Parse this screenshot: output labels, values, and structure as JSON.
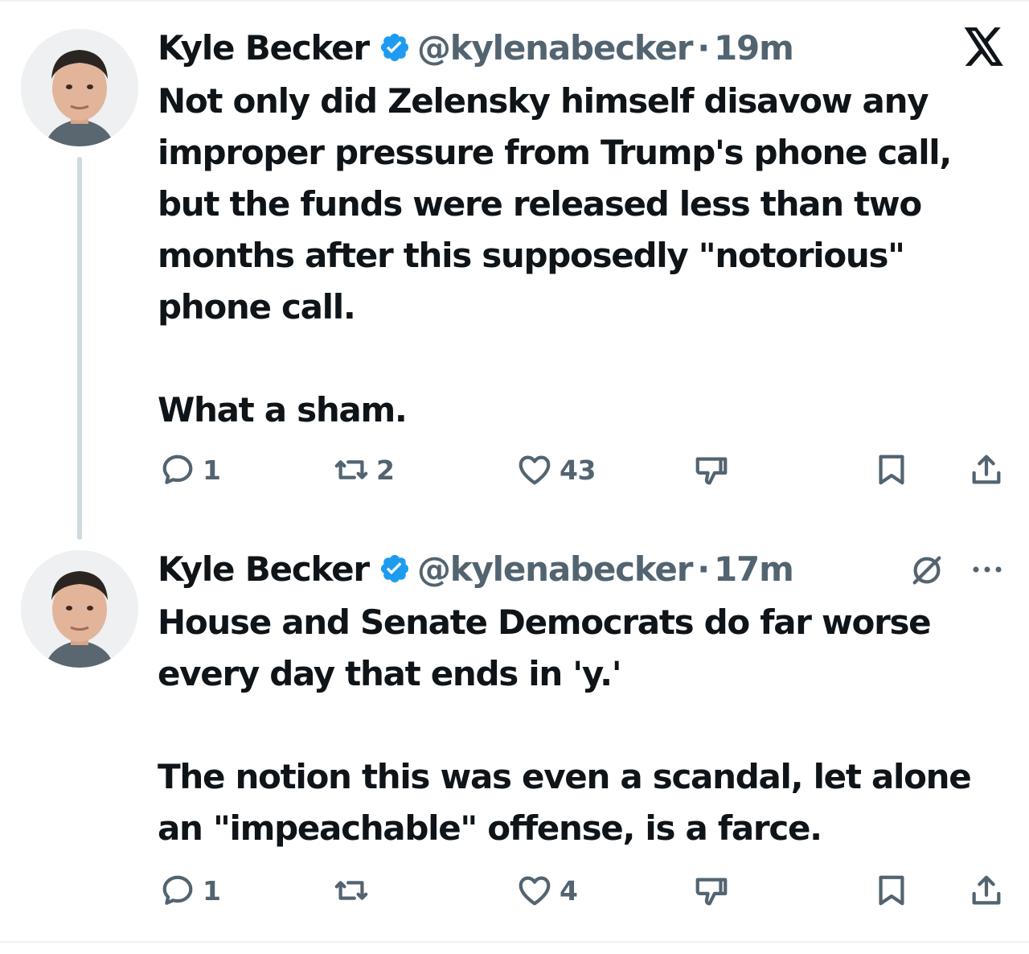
{
  "tweets": [
    {
      "author": "Kyle Becker",
      "handle": "@kylenabecker",
      "separator": "·",
      "time": "19m",
      "text": "Not only did Zelensky himself disavow any improper pressure from Trump's phone call, but the funds were released less than two months after this supposedly \"notorious\" phone call.\n\nWhat a sham.",
      "actions": {
        "reply": "1",
        "retweet": "2",
        "like": "43"
      }
    },
    {
      "author": "Kyle Becker",
      "handle": "@kylenabecker",
      "separator": "·",
      "time": "17m",
      "text": "House and Senate Democrats do far worse every day that ends in 'y.'\n\nThe notion this was even a scandal, let alone an \"impeachable\" offense, is a farce.",
      "actions": {
        "reply": "1",
        "retweet": "",
        "like": "4"
      }
    }
  ],
  "colors": {
    "text": "#0f1419",
    "secondary": "#536471",
    "verified": "#1d9bf0",
    "thread_line": "#cfd9de",
    "border": "#eff3f4"
  },
  "icons": [
    "verified-badge-icon",
    "x-logo-icon",
    "grok-icon",
    "more-icon",
    "reply-icon",
    "retweet-icon",
    "like-icon",
    "downvote-icon",
    "bookmark-icon",
    "share-icon"
  ]
}
